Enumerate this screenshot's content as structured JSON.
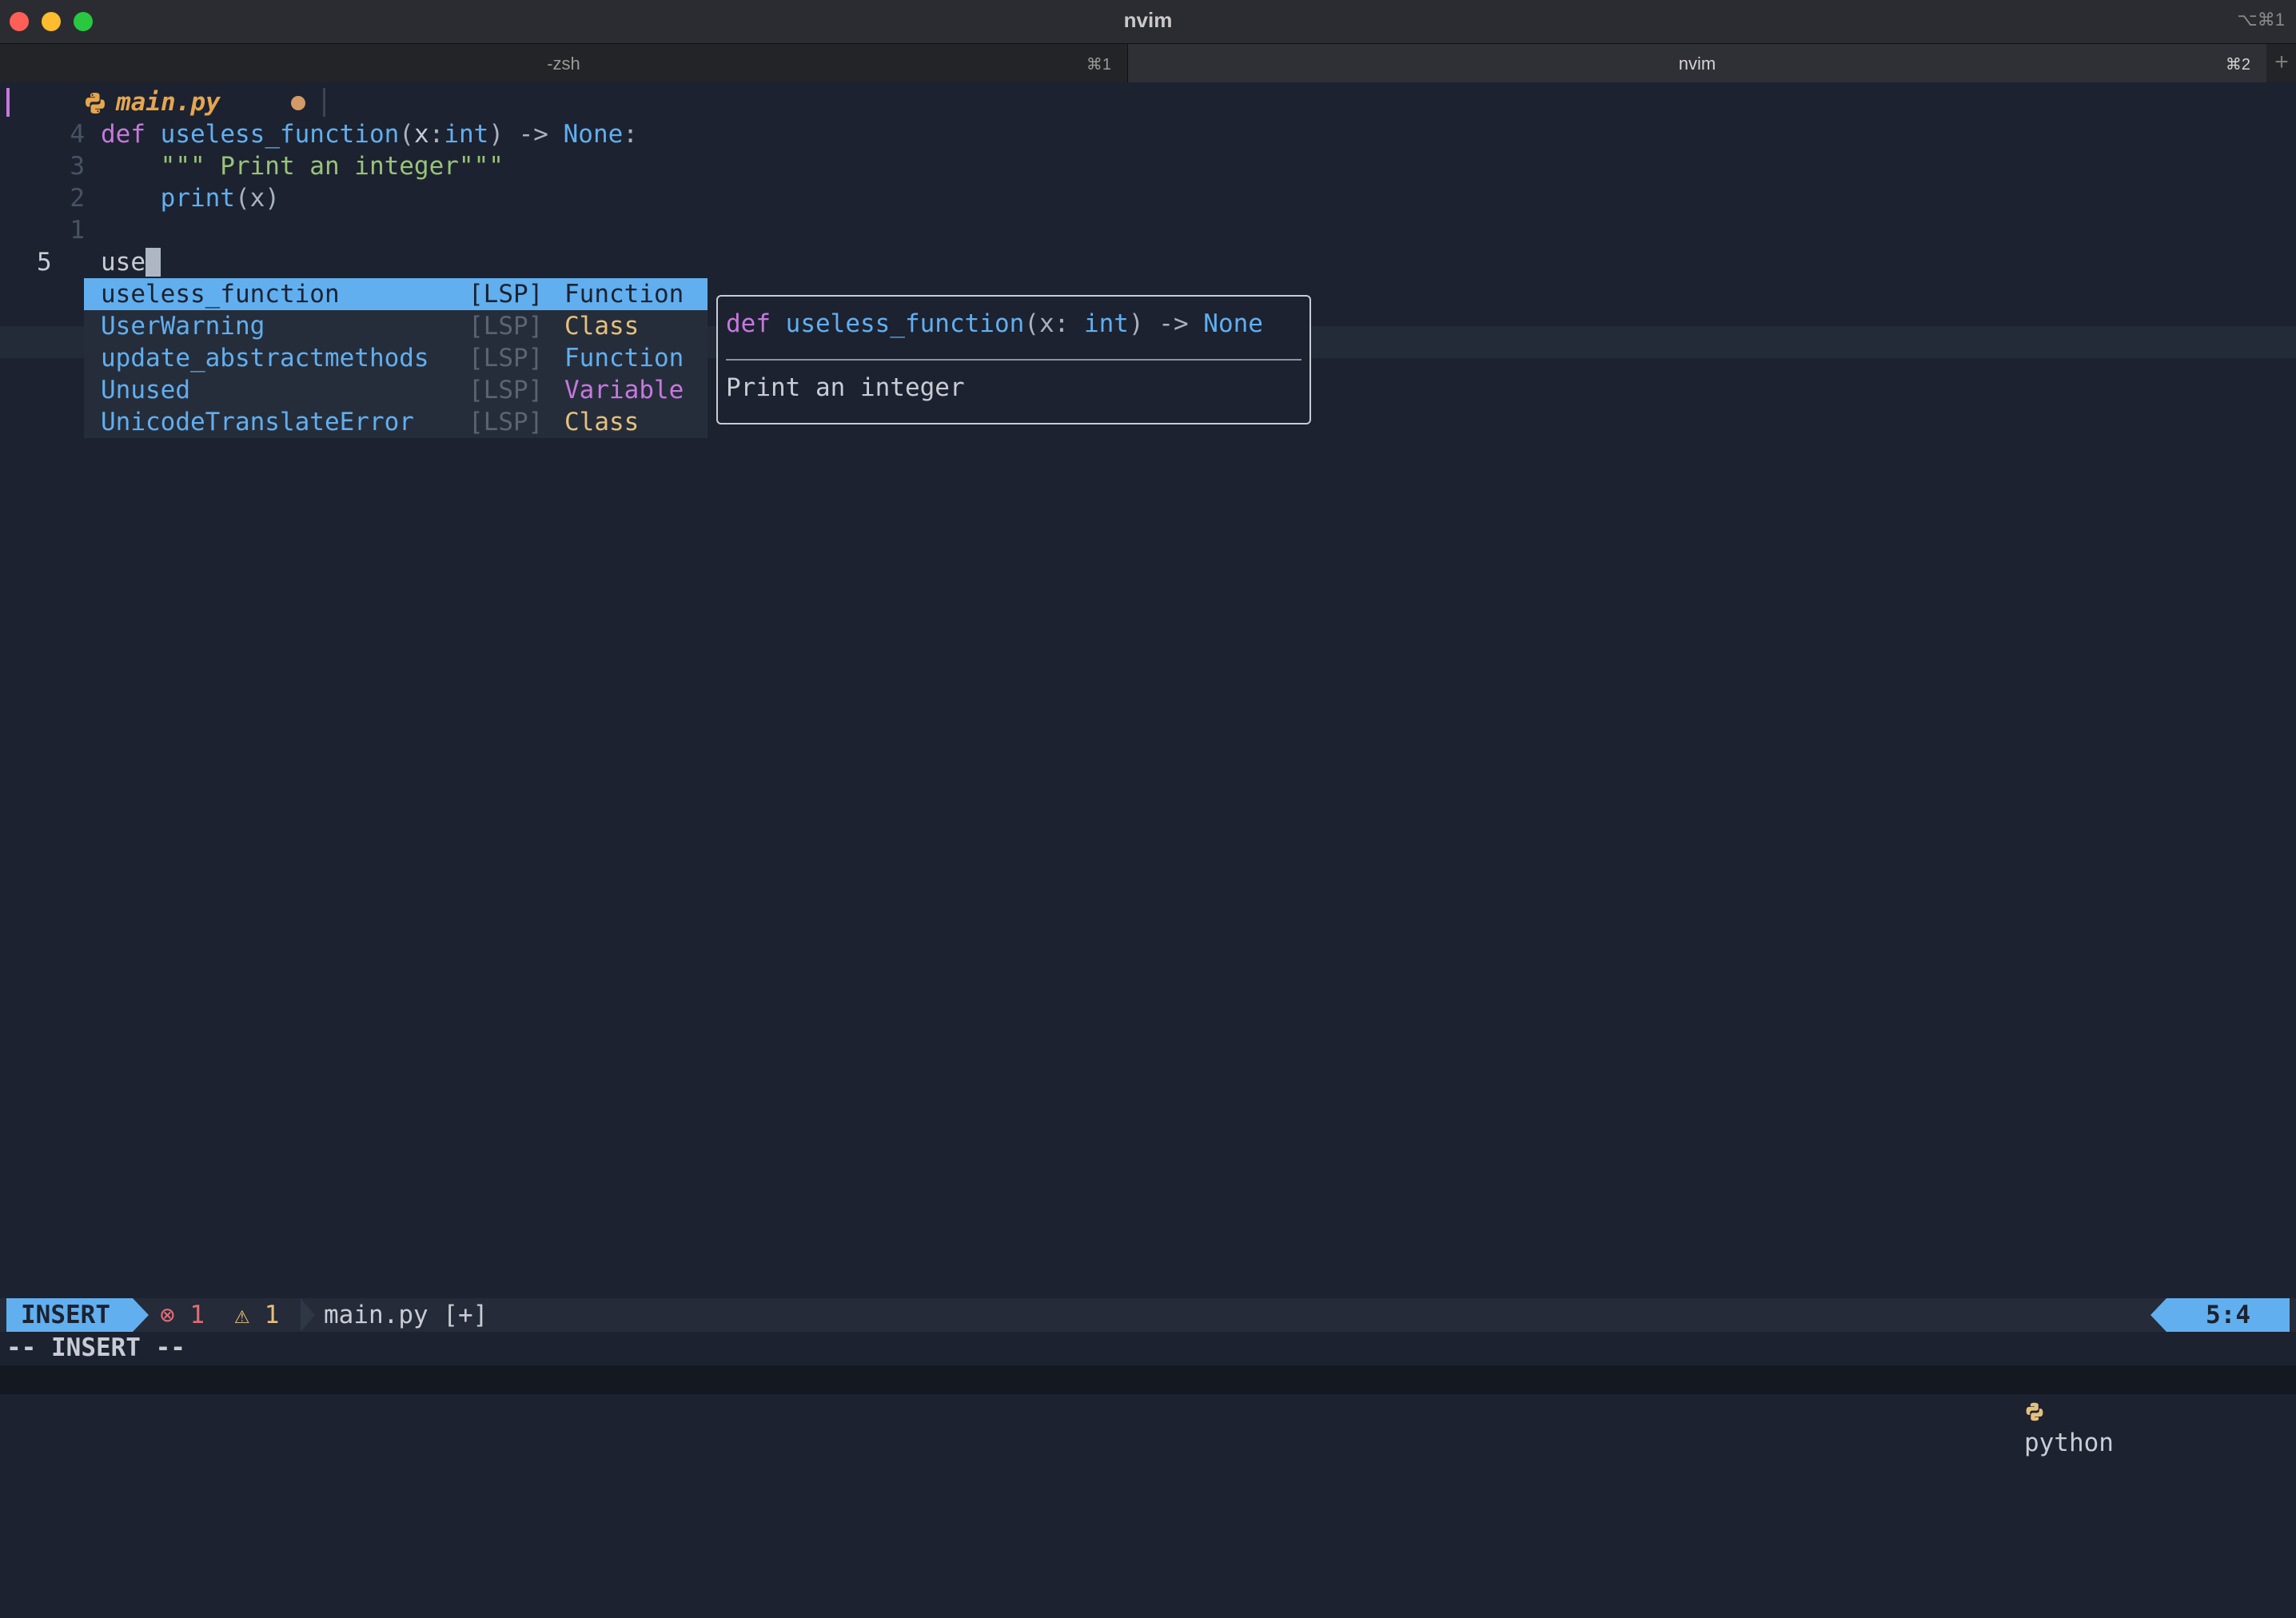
{
  "window": {
    "title": "nvim",
    "title_shortcut": "⌥⌘1"
  },
  "tabs": [
    {
      "label": "-zsh",
      "shortcut": "⌘1",
      "active": false
    },
    {
      "label": "nvim",
      "shortcut": "⌘2",
      "active": true
    }
  ],
  "tab_add_icon": "+",
  "buffer": {
    "filename": "main.py",
    "modified_dot": "●",
    "icon": "python-icon"
  },
  "code_lines": [
    {
      "number": "4",
      "tokens": [
        "def",
        " ",
        "useless_function",
        "(",
        "x",
        ":",
        "int",
        ") -> ",
        "None",
        ":"
      ]
    },
    {
      "number": "3",
      "tokens": [
        "    ",
        "\"\"\" Print an integer\"\"\""
      ]
    },
    {
      "number": "2",
      "tokens": [
        "    ",
        "print",
        "(x)"
      ]
    },
    {
      "number": "1",
      "tokens": [
        ""
      ]
    },
    {
      "number": "5",
      "tokens": [
        "use"
      ]
    }
  ],
  "completion": {
    "items": [
      {
        "word": "useless_function",
        "source": "[LSP]",
        "kind": "Function",
        "selected": true
      },
      {
        "word": "UserWarning",
        "source": "[LSP]",
        "kind": "Class",
        "selected": false
      },
      {
        "word": "update_abstractmethods",
        "source": "[LSP]",
        "kind": "Function",
        "selected": false
      },
      {
        "word": "Unused",
        "source": "[LSP]",
        "kind": "Variable",
        "selected": false
      },
      {
        "word": "UnicodeTranslateError",
        "source": "[LSP]",
        "kind": "Class",
        "selected": false
      }
    ]
  },
  "doc": {
    "sig_kw": "def",
    "sig_name": "useless_function",
    "sig_open": "(x: ",
    "sig_type": "int",
    "sig_close": ") -> ",
    "sig_ret": "None",
    "description": "Print an integer"
  },
  "statusline": {
    "mode": "INSERT",
    "errors_icon": "⊗",
    "errors": "1",
    "warnings_icon": "⚠",
    "warnings": "1",
    "file": "main.py [+]",
    "os_icon": "linux-tux-icon",
    "lang_icon": "python-icon",
    "language": "python",
    "position": "5:4"
  },
  "cmdline": "-- INSERT --",
  "colors": {
    "accent": "#61afef",
    "keyword": "#c678dd",
    "type": "#e5c07b",
    "string": "#98c379",
    "error": "#e06c75",
    "background": "#1c2230"
  }
}
